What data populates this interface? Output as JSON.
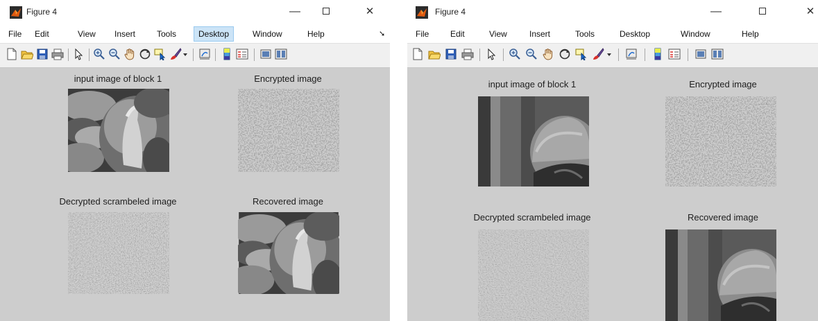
{
  "windows": [
    {
      "id": "left",
      "title": "Figure 4",
      "menu": [
        "File",
        "Edit",
        "View",
        "Insert",
        "Tools",
        "Desktop",
        "Window",
        "Help"
      ],
      "active_menu": "Desktop",
      "panels": {
        "input": "input image of block 1",
        "encrypted": "Encrypted image",
        "decrypted": "Decrypted scrambeled image",
        "recovered": "Recovered image"
      }
    },
    {
      "id": "right",
      "title": "Figure 4",
      "menu": [
        "File",
        "Edit",
        "View",
        "Insert",
        "Tools",
        "Desktop",
        "Window",
        "Help"
      ],
      "panels": {
        "input": "input image of block 1",
        "encrypted": "Encrypted image",
        "decrypted": "Decrypted scrambeled image",
        "recovered": "Recovered image"
      }
    }
  ],
  "toolbar_icons": [
    "new-figure-icon",
    "open-file-icon",
    "save-icon",
    "print-icon",
    "edit-plot-arrow-icon",
    "zoom-in-icon",
    "zoom-out-icon",
    "pan-hand-icon",
    "rotate-3d-icon",
    "data-cursor-icon",
    "brush-icon",
    "brush-dropdown-icon",
    "link-plot-icon",
    "insert-colorbar-icon",
    "insert-legend-icon",
    "hide-plot-tools-icon",
    "show-plot-tools-icon"
  ],
  "colors": {
    "figure_bg": "#cdcdcd",
    "toolbar_bg": "#f0f0f0",
    "menu_active": "#cce4f7",
    "logo": "#e05a10"
  }
}
